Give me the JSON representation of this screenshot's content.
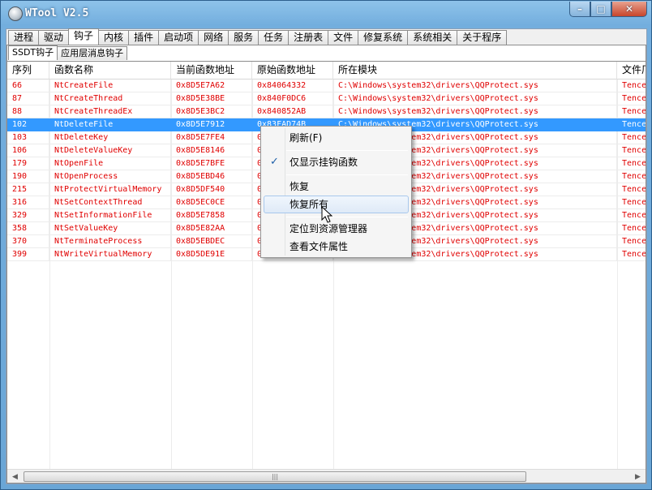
{
  "window": {
    "title": "WTool V2.5",
    "caption_minimize": "–",
    "caption_maximize": "□",
    "caption_close": "✕"
  },
  "tabs": [
    {
      "label": "进程"
    },
    {
      "label": "驱动"
    },
    {
      "label": "钩子",
      "active": true
    },
    {
      "label": "内核"
    },
    {
      "label": "插件"
    },
    {
      "label": "启动项"
    },
    {
      "label": "网络"
    },
    {
      "label": "服务"
    },
    {
      "label": "任务"
    },
    {
      "label": "注册表"
    },
    {
      "label": "文件"
    },
    {
      "label": "修复系统"
    },
    {
      "label": "系统相关"
    },
    {
      "label": "关于程序"
    }
  ],
  "subtabs": [
    {
      "label": "SSDT钩子",
      "active": true
    },
    {
      "label": "应用层消息钩子"
    }
  ],
  "columns": [
    "序列",
    "函数名称",
    "当前函数地址",
    "原始函数地址",
    "所在模块",
    "文件厂"
  ],
  "rows": [
    {
      "seq": "66",
      "name": "NtCreateFile",
      "cur": "0x8D5E7A62",
      "orig": "0x84064332",
      "module": "C:\\Windows\\system32\\drivers\\QQProtect.sys",
      "vendor": "Tencen"
    },
    {
      "seq": "87",
      "name": "NtCreateThread",
      "cur": "0x8D5E38BE",
      "orig": "0x840F0DC6",
      "module": "C:\\Windows\\system32\\drivers\\QQProtect.sys",
      "vendor": "Tencen"
    },
    {
      "seq": "88",
      "name": "NtCreateThreadEx",
      "cur": "0x8D5E3BC2",
      "orig": "0x840852AB",
      "module": "C:\\Windows\\system32\\drivers\\QQProtect.sys",
      "vendor": "Tencen"
    },
    {
      "seq": "102",
      "name": "NtDeleteFile",
      "cur": "0x8D5E7912",
      "orig": "0x83FAD74B",
      "module": "C:\\Windows\\system32\\drivers\\QQProtect.sys",
      "vendor": "Tencen",
      "selected": true
    },
    {
      "seq": "103",
      "name": "NtDeleteKey",
      "cur": "0x8D5E7FE4",
      "orig": "0x",
      "module": "C:\\Windows\\system32\\drivers\\QQProtect.sys",
      "vendor": "Tencen"
    },
    {
      "seq": "106",
      "name": "NtDeleteValueKey",
      "cur": "0x8D5E8146",
      "orig": "0x",
      "module": "C:\\Windows\\system32\\drivers\\QQProtect.sys",
      "vendor": "Tencen"
    },
    {
      "seq": "179",
      "name": "NtOpenFile",
      "cur": "0x8D5E7BFE",
      "orig": "0x",
      "module": "C:\\Windows\\system32\\drivers\\QQProtect.sys",
      "vendor": "Tencen"
    },
    {
      "seq": "190",
      "name": "NtOpenProcess",
      "cur": "0x8D5EBD46",
      "orig": "0x",
      "module": "C:\\Windows\\system32\\drivers\\QQProtect.sys",
      "vendor": "Tencen"
    },
    {
      "seq": "215",
      "name": "NtProtectVirtualMemory",
      "cur": "0x8D5DF540",
      "orig": "0x",
      "module": "C:\\Windows\\system32\\drivers\\QQProtect.sys",
      "vendor": "Tencen"
    },
    {
      "seq": "316",
      "name": "NtSetContextThread",
      "cur": "0x8D5EC0CE",
      "orig": "0x",
      "module": "C:\\Windows\\system32\\drivers\\QQProtect.sys",
      "vendor": "Tencen"
    },
    {
      "seq": "329",
      "name": "NtSetInformationFile",
      "cur": "0x8D5E7858",
      "orig": "0x",
      "module": "C:\\Windows\\system32\\drivers\\QQProtect.sys",
      "vendor": "Tencen"
    },
    {
      "seq": "358",
      "name": "NtSetValueKey",
      "cur": "0x8D5E82AA",
      "orig": "0x",
      "module": "C:\\Windows\\system32\\drivers\\QQProtect.sys",
      "vendor": "Tencen"
    },
    {
      "seq": "370",
      "name": "NtTerminateProcess",
      "cur": "0x8D5EBDEC",
      "orig": "0x",
      "module": "C:\\Windows\\system32\\drivers\\QQProtect.sys",
      "vendor": "Tencen"
    },
    {
      "seq": "399",
      "name": "NtWriteVirtualMemory",
      "cur": "0x8D5DE91E",
      "orig": "0x",
      "module": "C:\\Windows\\system32\\drivers\\QQProtect.sys",
      "vendor": "Tencen"
    }
  ],
  "context_menu": {
    "items": [
      {
        "label": "刷新(F)"
      },
      {
        "label": "仅显示挂钩函数",
        "checked": true
      },
      {
        "label": "恢复"
      },
      {
        "label": "恢复所有",
        "hover": true
      },
      {
        "label": "定位到资源管理器"
      },
      {
        "label": "查看文件属性"
      }
    ]
  },
  "scrollbar": {
    "grip": "|||",
    "left_arrow": "◀",
    "right_arrow": "▶"
  },
  "colors": {
    "hooked_text": "#e00000",
    "selection": "#3399ff",
    "menu_hover_border": "#a8c8ec"
  }
}
